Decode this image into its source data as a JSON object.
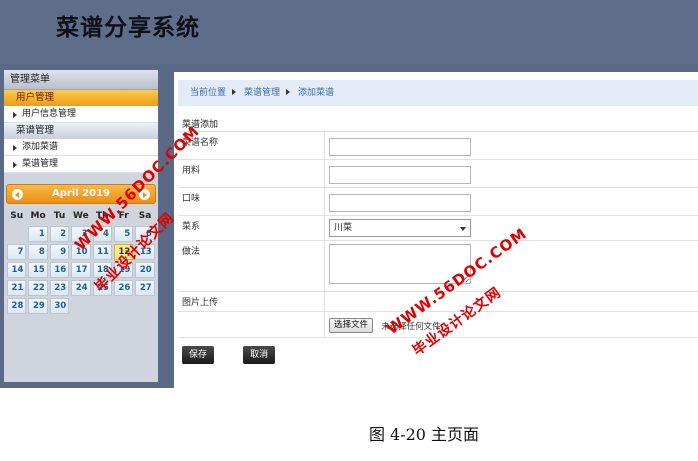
{
  "header": {
    "title": "菜谱分享系统"
  },
  "sidebar": {
    "title": "管理菜单",
    "groups": [
      {
        "label": "用户管理",
        "items": [
          "用户信息管理"
        ]
      },
      {
        "label": "菜谱管理",
        "items": [
          "添加菜谱",
          "菜谱管理"
        ]
      }
    ]
  },
  "calendar": {
    "month_label": "April 2019",
    "weekdays": [
      "Su",
      "Mo",
      "Tu",
      "We",
      "Th",
      "Fr",
      "Sa"
    ],
    "leading_blanks": 1,
    "days_in_month": 30,
    "today": 12
  },
  "breadcrumb": {
    "items": [
      "当前位置",
      "菜谱管理",
      "添加菜谱"
    ]
  },
  "form": {
    "title": "菜谱添加",
    "name_label": "菜谱名称",
    "ingredients_label": "用料",
    "flavor_label": "口味",
    "category_label": "菜系",
    "category_value": "川菜",
    "method_label": "做法",
    "image_label": "图片上传",
    "file_button": "选择文件",
    "file_status": "未选择任何文件",
    "save_label": "保存",
    "cancel_label": "取消"
  },
  "watermark": {
    "url": "WWW.56DOC.COM",
    "name": "毕业设计论文网"
  },
  "caption": "图 4-20 主页面",
  "colors": {
    "header": "#5e6d8a",
    "accent": "#ee9b16",
    "breadcrumb_bg": "#e3ecf6"
  }
}
